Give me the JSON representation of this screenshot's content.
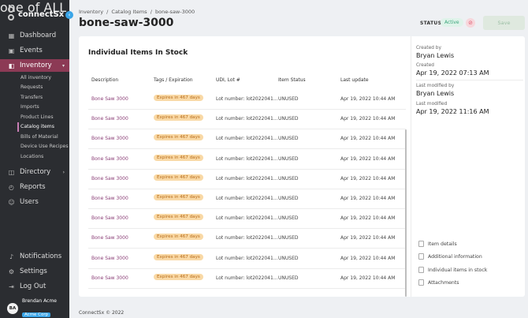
{
  "logo": {
    "text": "connectSx",
    "tagline": "one of ALL"
  },
  "sidebar": {
    "items": [
      {
        "label": "Dashboard",
        "icon": "dashboard-icon"
      },
      {
        "label": "Events",
        "icon": "calendar-icon"
      },
      {
        "label": "Inventory",
        "icon": "inventory-icon",
        "active": true
      }
    ],
    "inventory_sub": [
      "All inventory",
      "Requests",
      "Transfers",
      "Imports",
      "Product Lines",
      "Catalog items",
      "Bills of Material",
      "Device Use Recipes",
      "Locations"
    ],
    "lower_items": [
      {
        "label": "Directory",
        "icon": "directory-icon"
      },
      {
        "label": "Reports",
        "icon": "reports-icon"
      },
      {
        "label": "Users",
        "icon": "users-icon"
      }
    ],
    "bottom_items": [
      {
        "label": "Notifications",
        "icon": "bell-icon"
      },
      {
        "label": "Settings",
        "icon": "gear-icon"
      },
      {
        "label": "Log Out",
        "icon": "logout-icon"
      }
    ],
    "user": {
      "initials": "BA",
      "name": "Brendan Acme",
      "org": "Acme Corp"
    }
  },
  "breadcrumb": [
    "Inventory",
    "/",
    "Catalog Items",
    "/",
    "bone-saw-3000"
  ],
  "page_title": "bone-saw-3000",
  "status": {
    "label": "STATUS",
    "value": "Active"
  },
  "save_label": "Save",
  "card": {
    "title": "Individual Items In Stock",
    "columns": [
      "Description",
      "Tags / Expiration",
      "UDI, Lot #",
      "Item Status",
      "Last update"
    ],
    "rows": [
      {
        "desc": "Bone Saw 3000",
        "tag": "Expires in 467 days",
        "lot": "Lot number: lot2022041...",
        "status": "UNUSED",
        "updated": "Apr 19, 2022 10:44 AM"
      },
      {
        "desc": "Bone Saw 3000",
        "tag": "Expires in 467 days",
        "lot": "Lot number: lot2022041...",
        "status": "UNUSED",
        "updated": "Apr 19, 2022 10:44 AM"
      },
      {
        "desc": "Bone Saw 3000",
        "tag": "Expires in 467 days",
        "lot": "Lot number: lot2022041...",
        "status": "UNUSED",
        "updated": "Apr 19, 2022 10:44 AM"
      },
      {
        "desc": "Bone Saw 3000",
        "tag": "Expires in 467 days",
        "lot": "Lot number: lot2022041...",
        "status": "UNUSED",
        "updated": "Apr 19, 2022 10:44 AM"
      },
      {
        "desc": "Bone Saw 3000",
        "tag": "Expires in 467 days",
        "lot": "Lot number: lot2022041...",
        "status": "UNUSED",
        "updated": "Apr 19, 2022 10:44 AM"
      },
      {
        "desc": "Bone Saw 3000",
        "tag": "Expires in 467 days",
        "lot": "Lot number: lot2022041...",
        "status": "UNUSED",
        "updated": "Apr 19, 2022 10:44 AM"
      },
      {
        "desc": "Bone Saw 3000",
        "tag": "Expires in 467 days",
        "lot": "Lot number: lot2022041...",
        "status": "UNUSED",
        "updated": "Apr 19, 2022 10:44 AM"
      },
      {
        "desc": "Bone Saw 3000",
        "tag": "Expires in 467 days",
        "lot": "Lot number: lot2022041...",
        "status": "UNUSED",
        "updated": "Apr 19, 2022 10:44 AM"
      },
      {
        "desc": "Bone Saw 3000",
        "tag": "Expires in 467 days",
        "lot": "Lot number: lot2022041...",
        "status": "UNUSED",
        "updated": "Apr 19, 2022 10:44 AM"
      },
      {
        "desc": "Bone Saw 3000",
        "tag": "Expires in 467 days",
        "lot": "Lot number: lot2022041...",
        "status": "UNUSED",
        "updated": "Apr 19, 2022 10:44 AM"
      }
    ]
  },
  "meta": {
    "created_by_label": "Created by",
    "created_by": "Bryan Lewis",
    "created_label": "Created",
    "created": "Apr 19, 2022 07:13 AM",
    "modified_by_label": "Last modified by",
    "modified_by": "Bryan Lewis",
    "modified_label": "Last modified",
    "modified": "Apr 19, 2022 11:16 AM"
  },
  "side_links": [
    "Item details",
    "Additional information",
    "Individual items in stock",
    "Attachments"
  ],
  "footer": "ConnectSx © 2022"
}
